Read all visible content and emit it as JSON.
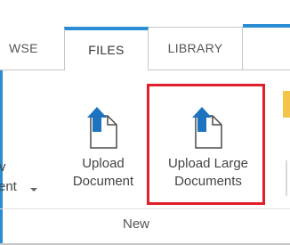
{
  "tabs": [
    {
      "label": "WSE"
    },
    {
      "label": "FILES"
    },
    {
      "label": "LIBRARY"
    }
  ],
  "ribbon": {
    "left_command": {
      "line1": "v",
      "line2": "ent"
    },
    "upload_document": {
      "line1": "Upload",
      "line2": "Document",
      "icon": "upload-document-icon"
    },
    "upload_large_documents": {
      "line1": "Upload Large",
      "line2": "Documents",
      "icon": "upload-document-icon"
    },
    "group_label": "New"
  },
  "colors": {
    "accent": "#2a8dd4",
    "highlight": "#e0202a"
  }
}
